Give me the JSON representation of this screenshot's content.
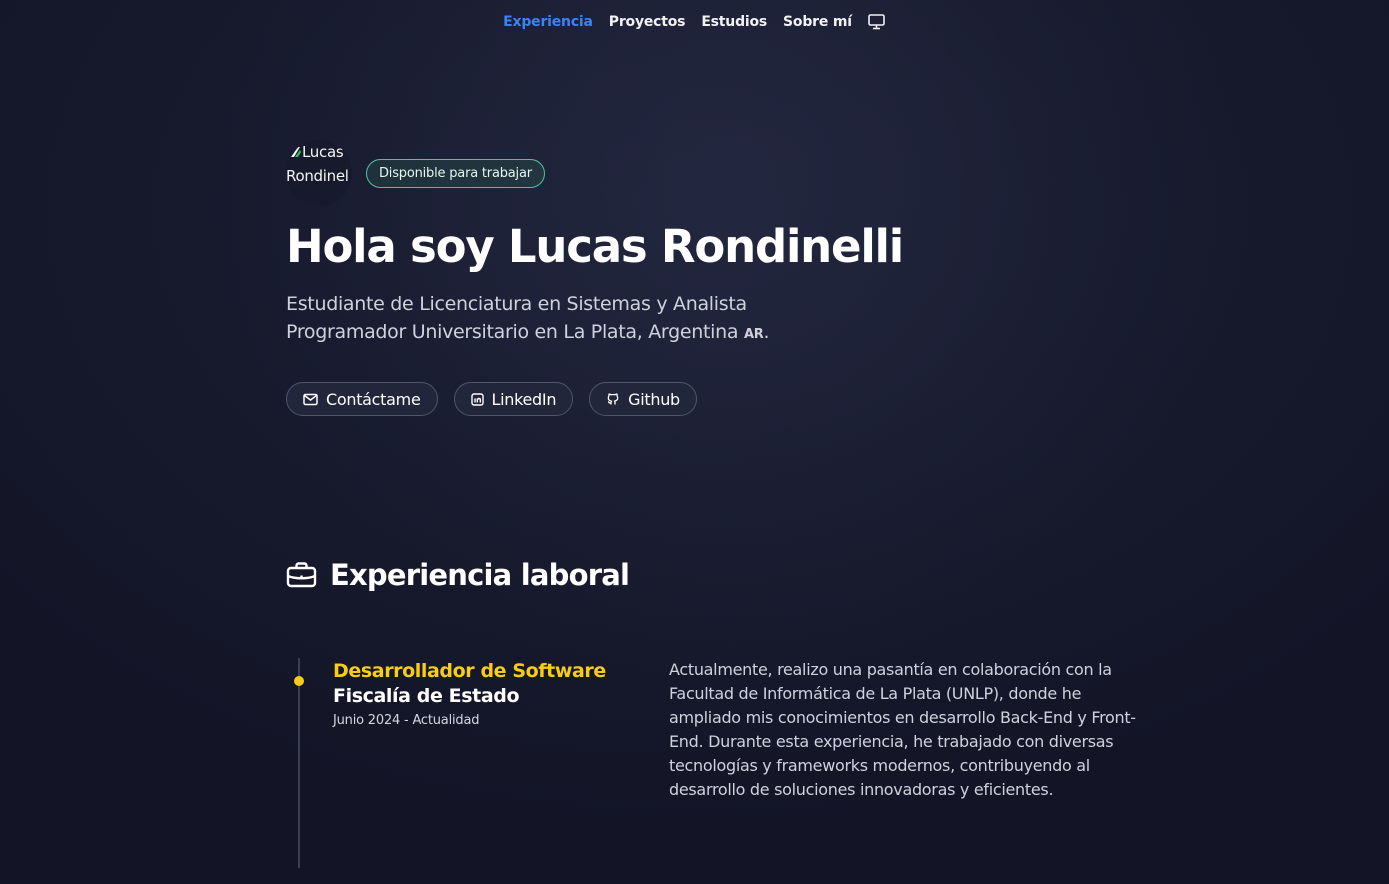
{
  "nav": {
    "items": [
      {
        "label": "Experiencia",
        "active": true
      },
      {
        "label": "Proyectos",
        "active": false
      },
      {
        "label": "Estudios",
        "active": false
      },
      {
        "label": "Sobre mí",
        "active": false
      }
    ],
    "theme_icon": "monitor-icon"
  },
  "hero": {
    "avatar_line1": "Lucas",
    "avatar_line2": "Rondinel",
    "badge": "Disponible para trabajar",
    "title": "Hola soy Lucas Rondinelli",
    "subtitle": "Estudiante de Licenciatura en Sistemas y Analista Programador Universitario en La Plata, Argentina",
    "flag": "AR",
    "flag_suffix": ".",
    "buttons": [
      {
        "label": "Contáctame",
        "icon": "mail-icon"
      },
      {
        "label": "LinkedIn",
        "icon": "linkedin-icon"
      },
      {
        "label": "Github",
        "icon": "github-icon"
      }
    ]
  },
  "experience": {
    "title": "Experiencia laboral",
    "icon": "briefcase-icon",
    "jobs": [
      {
        "role": "Desarrollador de Software",
        "company": "Fiscalía de Estado",
        "dates": "Junio 2024 - Actualidad",
        "description": "Actualmente, realizo una pasantía en colaboración con la Facultad de Informática de La Plata (UNLP), donde he ampliado mis conocimientos en desarrollo Back-End y Front-End. Durante esta experiencia, he trabajado con diversas tecnologías y frameworks modernos, contribuyendo al desarrollo de soluciones innovadoras y eficientes."
      }
    ]
  },
  "colors": {
    "accent_blue": "#3b82f6",
    "accent_yellow": "#facc15",
    "badge_border": "#4cc49a",
    "background": "#171a2d"
  }
}
